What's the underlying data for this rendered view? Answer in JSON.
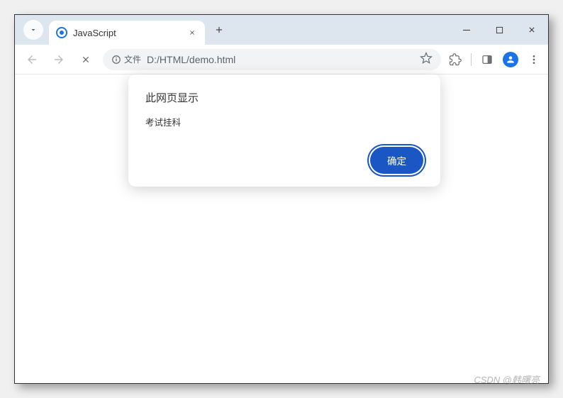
{
  "tab": {
    "title": "JavaScript"
  },
  "addressBar": {
    "protocolLabel": "文件",
    "url": "D:/HTML/demo.html"
  },
  "dialog": {
    "title": "此网页显示",
    "message": "考试挂科",
    "okLabel": "确定"
  },
  "watermark": "CSDN @韩曙亮"
}
